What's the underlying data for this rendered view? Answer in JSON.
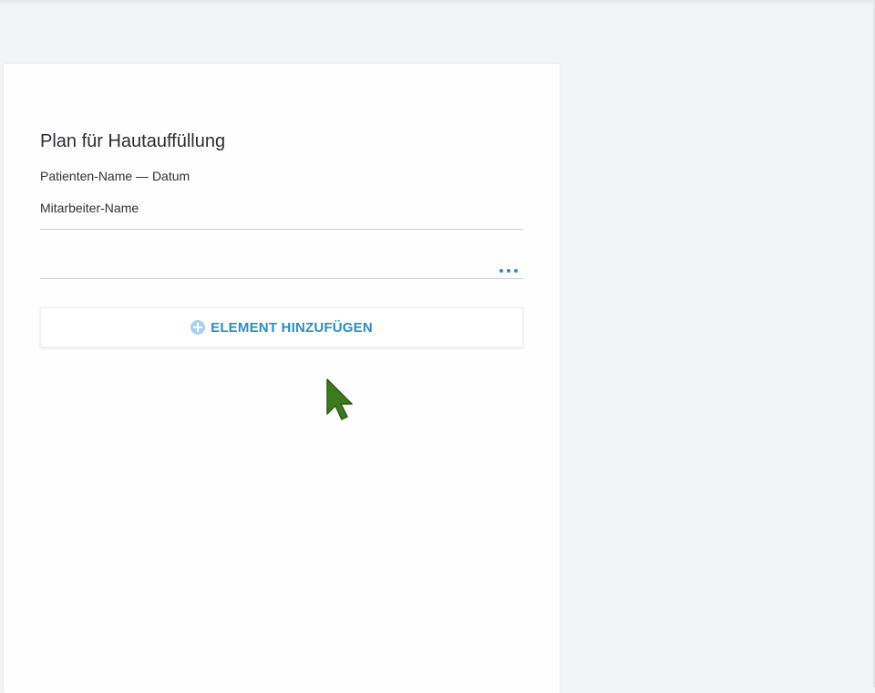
{
  "document": {
    "title": "Plan für Hautauffüllung",
    "patient_line": "Patienten-Name — Datum",
    "staff_line": "Mitarbeiter-Name"
  },
  "actions": {
    "add_element_label": "ELEMENT HINZUFÜGEN"
  },
  "icons": {
    "more": "more-horizontal-icon",
    "add": "plus-circle-icon",
    "cursor": "mouse-pointer-icon"
  },
  "colors": {
    "accent": "#2a8ec4",
    "accent_light": "#a8d3ea",
    "cursor": "#3d7a1e",
    "background": "#f2f4f5",
    "card": "#fefefe"
  }
}
